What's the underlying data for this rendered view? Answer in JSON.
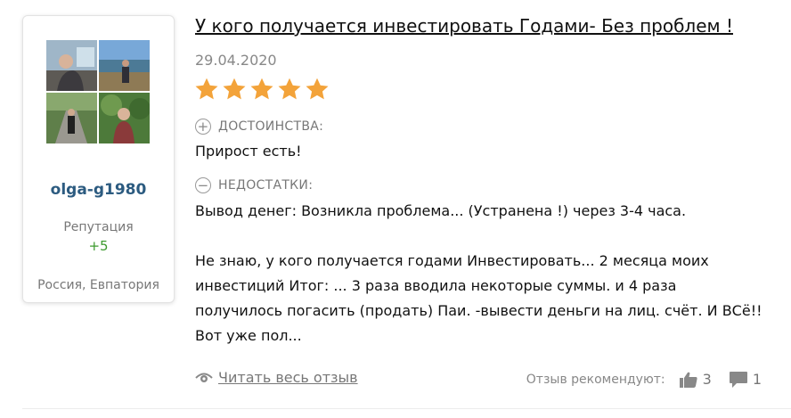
{
  "author": {
    "username": "olga-g1980",
    "reputation_label": "Репутация",
    "reputation_value": "+5",
    "location": "Россия, Евпатория"
  },
  "review": {
    "title": "У кого получается инвестировать Годами- Без проблем !",
    "date": "29.04.2020",
    "rating": 5,
    "pros_heading": "ДОСТОИНСТВА:",
    "pros_text": "Прирост есть!",
    "cons_heading": "НЕДОСТАТКИ:",
    "cons_text": "Вывод денег: Возникла проблема... (Устранена !) через 3-4 часа.",
    "body": "Не знаю, у кого получается годами Инвестировать... 2 месяца моих инвестиций Итог: ... 3 раза вводила некоторые суммы. и 4 раза получилось погасить (продать) Паи. -вывести деньги на лиц. счёт. И ВСё!! Вот уже пол..."
  },
  "footer": {
    "read_more": "Читать весь отзыв",
    "recommend_label": "Отзыв рекомендуют:",
    "likes": "3",
    "comments": "1"
  },
  "colors": {
    "star": "#f3a33a",
    "username": "#2c5b80",
    "reputation": "#3d9a2e"
  }
}
